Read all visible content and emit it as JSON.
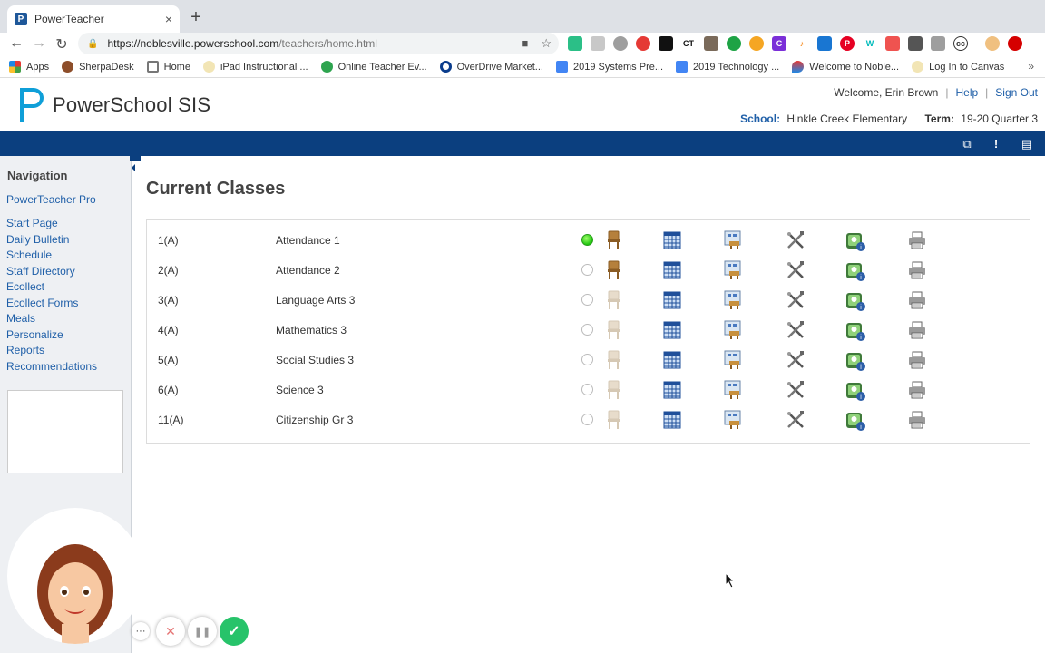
{
  "browser": {
    "tab_title": "PowerTeacher",
    "tab_close": "×",
    "new_tab": "+",
    "url_host": "https://noblesville.powerschool.com",
    "url_path": "/teachers/home.html",
    "bookmarks": [
      "Apps",
      "SherpaDesk",
      "Home",
      "iPad Instructional ...",
      "Online Teacher Ev...",
      "OverDrive Market...",
      "2019 Systems Pre...",
      "2019 Technology ...",
      "Welcome to Noble...",
      "Log In to Canvas"
    ],
    "bookmarks_more": "»"
  },
  "header": {
    "brand": "PowerSchool SIS",
    "welcome": "Welcome, Erin Brown",
    "help": "Help",
    "sign_out": "Sign Out",
    "school_label": "School:",
    "school_name": "Hinkle Creek Elementary",
    "term_label": "Term:",
    "term_value": "19-20 Quarter 3"
  },
  "sidebar": {
    "heading": "Navigation",
    "pro_link": "PowerTeacher Pro",
    "links": [
      "Start Page",
      "Daily Bulletin",
      "Schedule",
      "Staff Directory",
      "Ecollect",
      "Ecollect Forms",
      "Meals",
      "Personalize",
      "Reports",
      "Recommendations"
    ]
  },
  "main": {
    "title": "Current Classes",
    "classes": [
      {
        "period": "1(A)",
        "name": "Attendance 1",
        "attendance_taken": true,
        "seat_active": true
      },
      {
        "period": "2(A)",
        "name": "Attendance 2",
        "attendance_taken": false,
        "seat_active": true
      },
      {
        "period": "3(A)",
        "name": "Language Arts 3",
        "attendance_taken": false,
        "seat_active": false
      },
      {
        "period": "4(A)",
        "name": "Mathematics 3",
        "attendance_taken": false,
        "seat_active": false
      },
      {
        "period": "5(A)",
        "name": "Social Studies 3",
        "attendance_taken": false,
        "seat_active": false
      },
      {
        "period": "6(A)",
        "name": "Science 3",
        "attendance_taken": false,
        "seat_active": false
      },
      {
        "period": "11(A)",
        "name": "Citizenship Gr 3",
        "attendance_taken": false,
        "seat_active": false
      }
    ]
  },
  "colors": {
    "brand_blue": "#0b3f7f",
    "link_blue": "#1f5fa8",
    "logo_teal": "#0f9fd8",
    "check_green": "#1ec40e"
  },
  "recorder": {
    "more": "···",
    "cancel": "✕",
    "pause": "❚❚",
    "done": "✓"
  }
}
